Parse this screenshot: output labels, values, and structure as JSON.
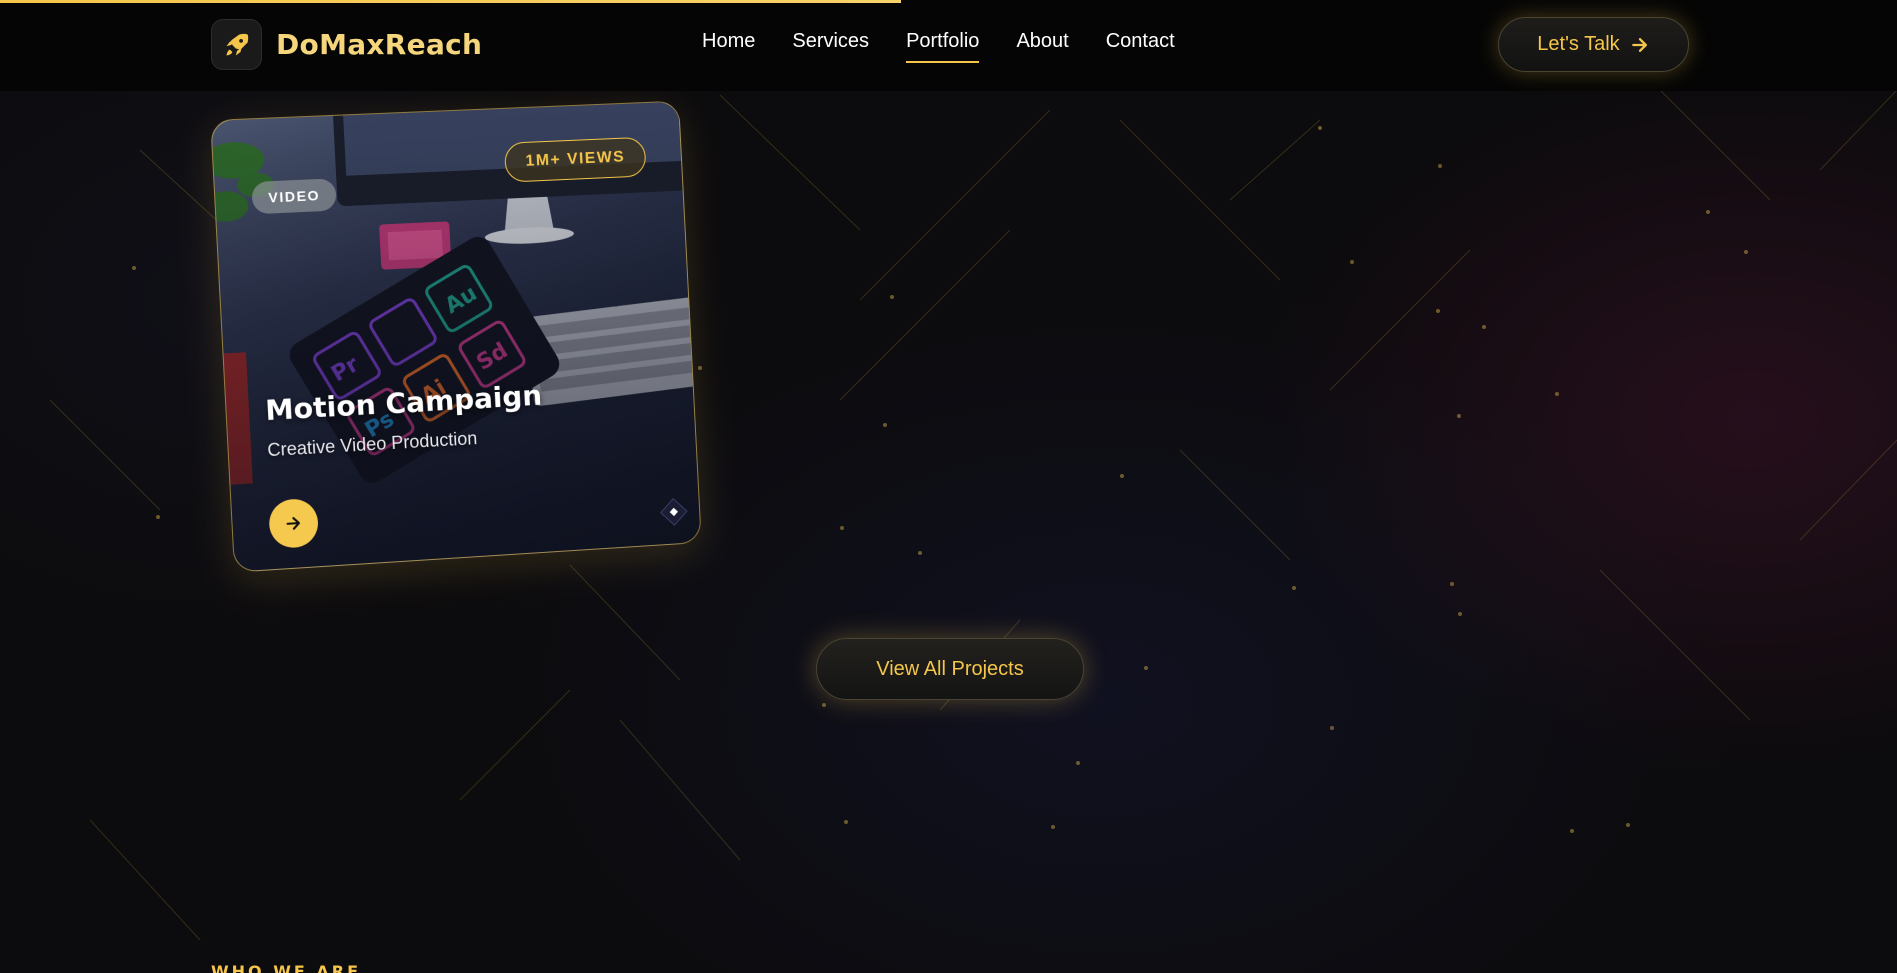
{
  "brand": {
    "name": "DoMaxReach",
    "logo_icon": "rocket-icon",
    "accent_color": "#f5c64a"
  },
  "nav": {
    "items": [
      {
        "label": "Home",
        "active": false
      },
      {
        "label": "Services",
        "active": false
      },
      {
        "label": "Portfolio",
        "active": true
      },
      {
        "label": "About",
        "active": false
      },
      {
        "label": "Contact",
        "active": false
      }
    ],
    "cta_label": "Let's Talk",
    "cta_icon": "arrow-right-icon"
  },
  "portfolio_card": {
    "category": "VIDEO",
    "stat_badge": "1M+ VIEWS",
    "title": "Motion Campaign",
    "subtitle": "Creative Video Production",
    "button_icon": "arrow-right-icon"
  },
  "view_all_label": "View All Projects",
  "next_section_label": "WHO WE ARE"
}
